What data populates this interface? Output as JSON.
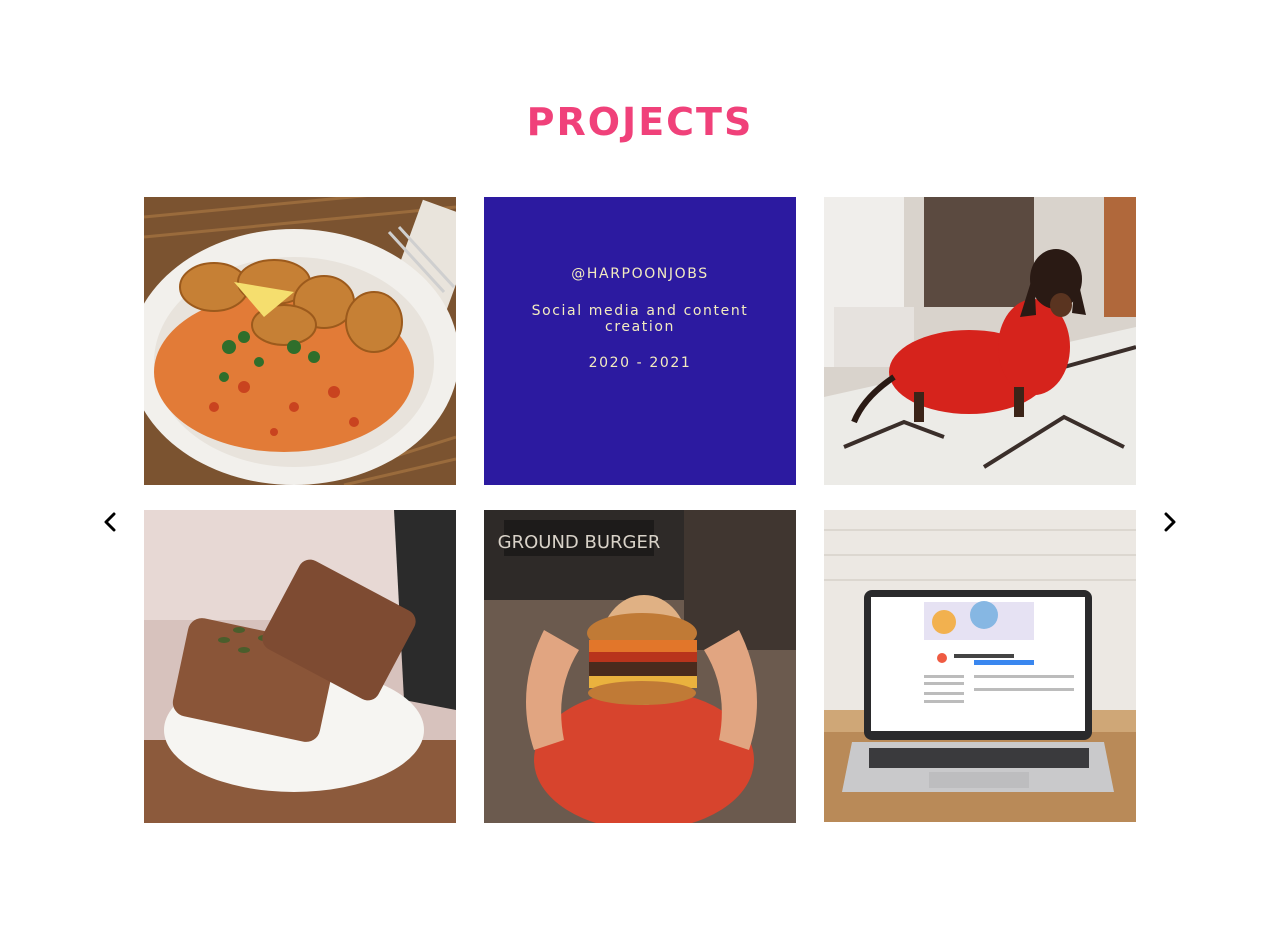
{
  "section": {
    "title": "PROJECTS"
  },
  "gallery": {
    "items": [
      {
        "kind": "image",
        "icon": "food-plate-image"
      },
      {
        "kind": "text",
        "handle": "@HARPOONJOBS",
        "description": "Social media and content creation",
        "years": "2020 - 2021",
        "background": "#2c1aa0",
        "text_color": "#f3ecc0"
      },
      {
        "kind": "image",
        "icon": "dog-in-sweater-image"
      },
      {
        "kind": "image",
        "icon": "bread-plate-image"
      },
      {
        "kind": "image",
        "icon": "burger-image"
      },
      {
        "kind": "image",
        "icon": "laptop-image"
      }
    ]
  },
  "navigation": {
    "prev_icon": "chevron-left-icon",
    "next_icon": "chevron-right-icon"
  },
  "colors": {
    "title": "#f0417a",
    "tile_background": "#2c1aa0"
  }
}
